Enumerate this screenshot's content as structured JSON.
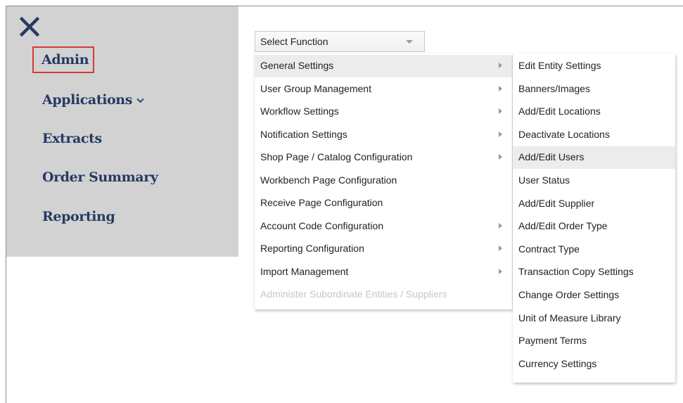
{
  "sidebar": {
    "close_icon": "close-icon",
    "items": [
      {
        "label": "Admin",
        "selected": true
      },
      {
        "label": "Applications",
        "has_dropdown": true
      },
      {
        "label": "Extracts"
      },
      {
        "label": "Order Summary"
      },
      {
        "label": "Reporting"
      }
    ]
  },
  "function_select": {
    "value": "Select Function",
    "icon": "chevron-down-icon"
  },
  "main_menu": [
    {
      "label": "General Settings",
      "has_submenu": true,
      "active": true
    },
    {
      "label": "User Group Management",
      "has_submenu": true
    },
    {
      "label": "Workflow Settings",
      "has_submenu": true
    },
    {
      "label": "Notification Settings",
      "has_submenu": true
    },
    {
      "label": "Shop Page / Catalog Configuration",
      "has_submenu": true
    },
    {
      "label": "Workbench Page Configuration",
      "has_submenu": false
    },
    {
      "label": "Receive Page Configuration",
      "has_submenu": false
    },
    {
      "label": "Account Code Configuration",
      "has_submenu": true
    },
    {
      "label": "Reporting Configuration",
      "has_submenu": true
    },
    {
      "label": "Import Management",
      "has_submenu": true
    },
    {
      "label": "Administer Subordinate Entities / Suppliers",
      "disabled": true
    }
  ],
  "submenu": [
    {
      "label": "Edit Entity Settings"
    },
    {
      "label": "Banners/Images"
    },
    {
      "label": "Add/Edit Locations"
    },
    {
      "label": "Deactivate Locations"
    },
    {
      "label": "Add/Edit Users",
      "active": true
    },
    {
      "label": "User Status"
    },
    {
      "label": "Add/Edit Supplier"
    },
    {
      "label": "Add/Edit Order Type"
    },
    {
      "label": "Contract Type"
    },
    {
      "label": "Transaction Copy Settings"
    },
    {
      "label": "Change Order Settings"
    },
    {
      "label": "Unit of Measure Library"
    },
    {
      "label": "Payment Terms"
    },
    {
      "label": "Currency Settings"
    }
  ],
  "colors": {
    "sidebar_bg": "#d2d2d2",
    "nav_text": "#243b62",
    "highlight_border": "#d23b3b",
    "menu_hover": "#ececec",
    "disabled_text": "#c6c6c6"
  }
}
